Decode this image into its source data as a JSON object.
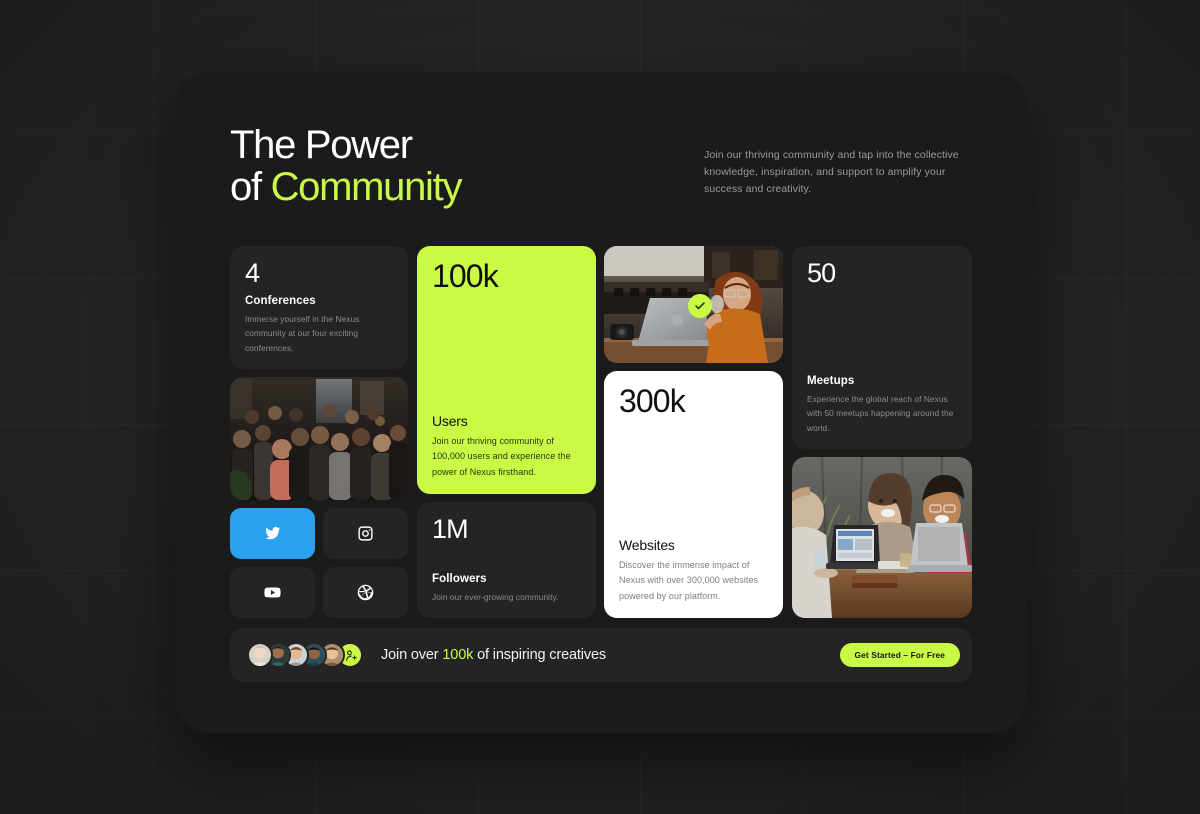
{
  "page": {
    "background_color": "#343434",
    "panel_color": "#1b1b1b",
    "accent_color": "#c9fa46",
    "twitter_color": "#2ba2ef"
  },
  "header": {
    "title_line1": "The Power",
    "title_line2_prefix": "of ",
    "title_line2_accent": "Community",
    "subcopy": "Join our thriving community and tap into the collective knowledge, inspiration, and support to amplify your success and creativity."
  },
  "cards": {
    "conferences": {
      "value": "4",
      "title": "Conferences",
      "description": "Immerse yourself in the Nexus community at our four exciting conferences."
    },
    "users": {
      "value": "100k",
      "title": "Users",
      "description": "Join our thriving community of 100,000 users and experience the power of Nexus firsthand."
    },
    "followers": {
      "value": "1M",
      "title": "Followers",
      "description": "Join our ever-growing community."
    },
    "websites": {
      "value": "300k",
      "title": "Websites",
      "description": "Discover the immense impact of Nexus with over 300,000 websites powered by our platform."
    },
    "meetups": {
      "value": "50",
      "title": "Meetups",
      "description": "Experience the global reach of Nexus with 50 meetups happening around the world."
    }
  },
  "photos": {
    "group": {
      "alt": "Large group of people posing and cheering together"
    },
    "woman_laptop": {
      "alt": "Woman with curly red hair drinking from a glass beside a laptop in a cafe",
      "badge_icon": "check-icon"
    },
    "team_table": {
      "alt": "Three people laughing around a wooden table with laptops"
    }
  },
  "social": {
    "items": [
      {
        "name": "twitter",
        "icon": "twitter-icon",
        "label": "Twitter",
        "active": true
      },
      {
        "name": "instagram",
        "icon": "instagram-icon",
        "label": "Instagram",
        "active": false
      },
      {
        "name": "youtube",
        "icon": "youtube-icon",
        "label": "YouTube",
        "active": false
      },
      {
        "name": "dribbble",
        "icon": "dribbble-icon",
        "label": "Dribbble",
        "active": false
      }
    ]
  },
  "cta": {
    "text_prefix": "Join over ",
    "text_accent": "100k",
    "text_suffix": " of inspiring creatives",
    "button_label": "Get Started – For Free",
    "avatar_count": 5,
    "add_icon": "person-add-icon"
  }
}
